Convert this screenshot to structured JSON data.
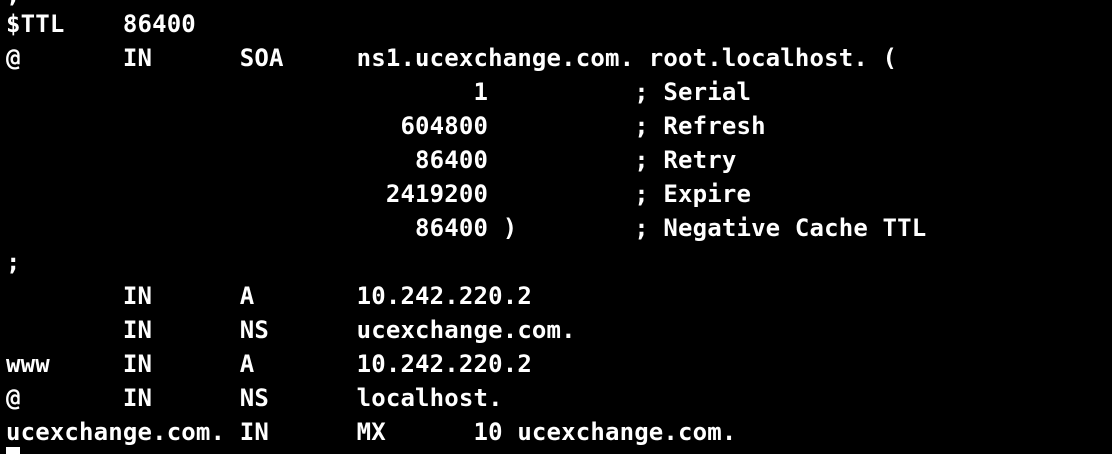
{
  "terminal": {
    "lines": [
      ";",
      "$TTL    86400",
      "@       IN      SOA     ns1.ucexchange.com. root.localhost. (",
      "                                1          ; Serial",
      "                           604800          ; Refresh",
      "                            86400          ; Retry",
      "                          2419200          ; Expire",
      "                            86400 )        ; Negative Cache TTL",
      ";",
      "        IN      A       10.242.220.2",
      "        IN      NS      ucexchange.com.",
      "www     IN      A       10.242.220.2",
      "@       IN      NS      localhost.",
      "ucexchange.com. IN      MX      10 ucexchange.com.",
      ""
    ]
  },
  "colors": {
    "background": "#000000",
    "foreground": "#ffffff"
  }
}
